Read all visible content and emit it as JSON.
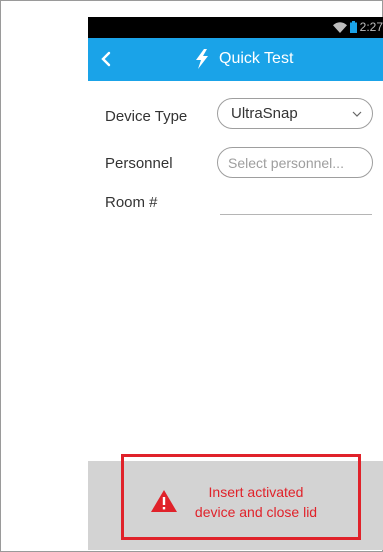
{
  "status_bar": {
    "time": "2:27",
    "wifi_icon": "wifi-icon",
    "battery_icon": "battery-icon"
  },
  "app_bar": {
    "title": "Quick Test",
    "back_icon": "chevron-left-icon",
    "title_icon": "lightning-bolt-icon",
    "color": "#1aa3e8"
  },
  "form": {
    "device_type_label": "Device Type",
    "device_type_value": "UltraSnap",
    "personnel_label": "Personnel",
    "personnel_placeholder": "Select personnel...",
    "room_label": "Room #",
    "room_value": ""
  },
  "alert": {
    "icon": "warning-icon",
    "line1": "Insert activated",
    "line2": "device and close lid",
    "color": "#e0222a"
  }
}
